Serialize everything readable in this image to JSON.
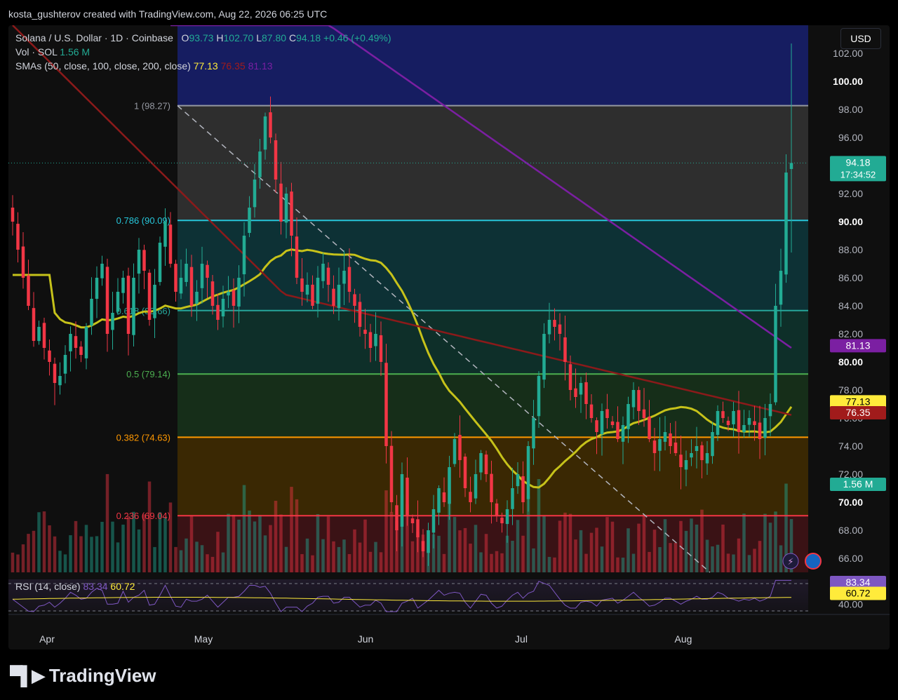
{
  "header": {
    "credit": "kosta_gushterov created with TradingView.com, Aug 22, 2026 06:25 UTC"
  },
  "legend": {
    "symbol": "Solana / U.S. Dollar · 1D · Coinbase",
    "o_label": "O",
    "o_value": "93.73",
    "h_label": "H",
    "h_value": "102.70",
    "l_label": "L",
    "l_value": "87.80",
    "c_label": "C",
    "c_value": "94.18",
    "change": "+0.46 (+0.49%)",
    "vol_label": "Vol · SOL",
    "vol_value": "1.56 M",
    "sma_label": "SMAs (50, close, 100, close, 200, close)",
    "sma50": "77.13",
    "sma100": "76.35",
    "sma200": "81.13"
  },
  "currency": "USD",
  "rsi": {
    "label": "RSI (14, close)",
    "value": "83.34",
    "ma": "60.72",
    "axis_label": "40.00"
  },
  "footer_logo": "TradingView",
  "colors": {
    "up": "#22ab94",
    "down": "#f23645",
    "sma50": "#c6c21a",
    "sma100": "#8b1a1a",
    "sma200": "#7b1fa2",
    "fib1": "#9598a1",
    "fib786": "#26c6da",
    "fib618": "#26a69a",
    "fib5": "#4caf50",
    "fib382": "#ff9800",
    "fib236": "#f23645"
  },
  "chart_data": {
    "type": "candlestick",
    "title": "Solana / U.S. Dollar · 1D · Coinbase",
    "y_axis": {
      "ylim": [
        65,
        104
      ],
      "ticks": [
        "66.00",
        "68.00",
        "70.00",
        "72.00",
        "74.00",
        "76.00",
        "78.00",
        "80.00",
        "82.00",
        "84.00",
        "86.00",
        "88.00",
        "90.00",
        "92.00",
        "94.00",
        "96.00",
        "98.00",
        "100.00",
        "102.00"
      ],
      "bold_ticks": [
        "70.00",
        "80.00",
        "90.00",
        "100.00"
      ]
    },
    "x_axis": {
      "labels": [
        "Apr",
        "May",
        "Jun",
        "Jul",
        "Aug"
      ]
    },
    "fib_levels": [
      {
        "label": "1 (98.27)",
        "value": 98.27
      },
      {
        "label": "0.786 (90.09)",
        "value": 90.09
      },
      {
        "label": "0.618 (83.66)",
        "value": 83.66
      },
      {
        "label": "0.5 (79.14)",
        "value": 79.14
      },
      {
        "label": "0.382 (74.63)",
        "value": 74.63
      },
      {
        "label": "0.236 (69.04)",
        "value": 69.04
      }
    ],
    "price_tags": [
      {
        "label": "94.18",
        "sub": "17:34:52",
        "value": 94.18,
        "color": "#22ab94"
      },
      {
        "label": "81.13",
        "value": 81.13,
        "color": "#7b1fa2"
      },
      {
        "label": "77.13",
        "value": 77.13,
        "color": "#ffeb3b"
      },
      {
        "label": "76.35",
        "value": 76.35,
        "color": "#a11b1b"
      },
      {
        "label": "1.56 M",
        "value": 71.25,
        "color": "#22ab94"
      }
    ],
    "closes": [
      90.0,
      88.0,
      86.0,
      84.0,
      81.5,
      82.5,
      81.0,
      80.0,
      78.5,
      79.0,
      80.5,
      82.0,
      81.0,
      80.5,
      82.5,
      84.5,
      86.0,
      87.0,
      82.0,
      83.5,
      85.0,
      86.0,
      82.0,
      86.0,
      88.0,
      86.5,
      83.0,
      85.5,
      88.5,
      90.0,
      87.0,
      85.0,
      86.0,
      87.0,
      84.0,
      85.0,
      87.0,
      86.0,
      84.0,
      83.0,
      84.5,
      85.0,
      84.0,
      86.0,
      89.0,
      91.0,
      93.0,
      95.0,
      97.5,
      96.0,
      93.0,
      90.0,
      92.0,
      89.0,
      86.0,
      85.0,
      85.5,
      84.0,
      86.0,
      87.0,
      85.5,
      84.0,
      85.5,
      86.5,
      85.0,
      84.0,
      82.5,
      82.0,
      81.0,
      82.0,
      80.0,
      74.0,
      70.0,
      68.0,
      72.0,
      69.0,
      68.5,
      67.5,
      66.5,
      68.0,
      69.5,
      71.0,
      70.0,
      72.5,
      74.5,
      73.0,
      71.0,
      70.0,
      72.0,
      73.5,
      72.0,
      70.0,
      69.0,
      68.5,
      69.5,
      71.0,
      72.0,
      70.0,
      74.0,
      76.0,
      79.0,
      82.0,
      83.0,
      82.5,
      82.0,
      80.0,
      78.0,
      77.5,
      78.5,
      77.0,
      76.0,
      75.0,
      76.5,
      76.0,
      75.5,
      74.5,
      75.5,
      77.0,
      78.0,
      76.5,
      76.0,
      74.5,
      73.5,
      74.5,
      75.0,
      74.0,
      73.5,
      72.5,
      73.0,
      73.5,
      74.0,
      73.0,
      73.5,
      75.0,
      76.5,
      76.0,
      75.5,
      76.5,
      75.0,
      75.5,
      76.0,
      75.5,
      74.5,
      76.0,
      77.0,
      84.0,
      86.5,
      93.5,
      94.18
    ],
    "volume_scale_max": 1.0,
    "rsi": {
      "overbought": 70,
      "oversold": 30,
      "latest": 83.34,
      "ma_latest": 60.72
    }
  }
}
